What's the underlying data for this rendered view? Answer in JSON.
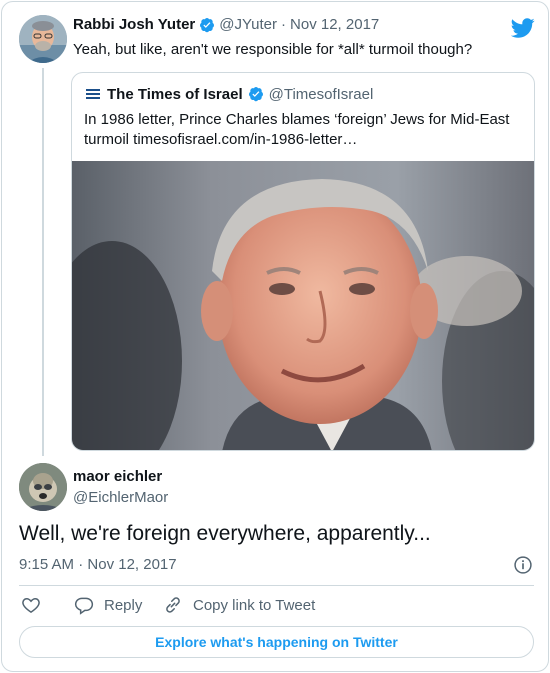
{
  "parent_tweet": {
    "author_name": "Rabbi Josh Yuter",
    "handle": "@JYuter",
    "separator": "·",
    "date": "Nov 12, 2017",
    "text": "Yeah, but like, aren't we responsible for *all* turmoil though?"
  },
  "quoted_tweet": {
    "author_name": "The Times of Israel",
    "handle": "@TimesofIsrael",
    "text_line1": "In 1986 letter, Prince Charles blames ‘foreign’ Jews for Mid-East",
    "text_line2": "turmoil timesofisrael.com/in-1986-letter…"
  },
  "main_tweet": {
    "author_name": "maor eichler",
    "handle": "@EichlerMaor",
    "text": "Well, we're foreign everywhere, apparently...",
    "time": "9:15 AM",
    "separator": "·",
    "date": "Nov 12, 2017"
  },
  "actions": {
    "reply_label": "Reply",
    "copy_link_label": "Copy link to Tweet"
  },
  "footer": {
    "explore_label": "Explore what's happening on Twitter"
  },
  "colors": {
    "twitter_blue": "#1d9bf0",
    "secondary_text": "#536471",
    "border": "#cfd9de"
  },
  "icons": [
    "verified-badge-icon",
    "twitter-bird-icon",
    "info-icon",
    "heart-icon",
    "reply-icon",
    "link-icon"
  ]
}
